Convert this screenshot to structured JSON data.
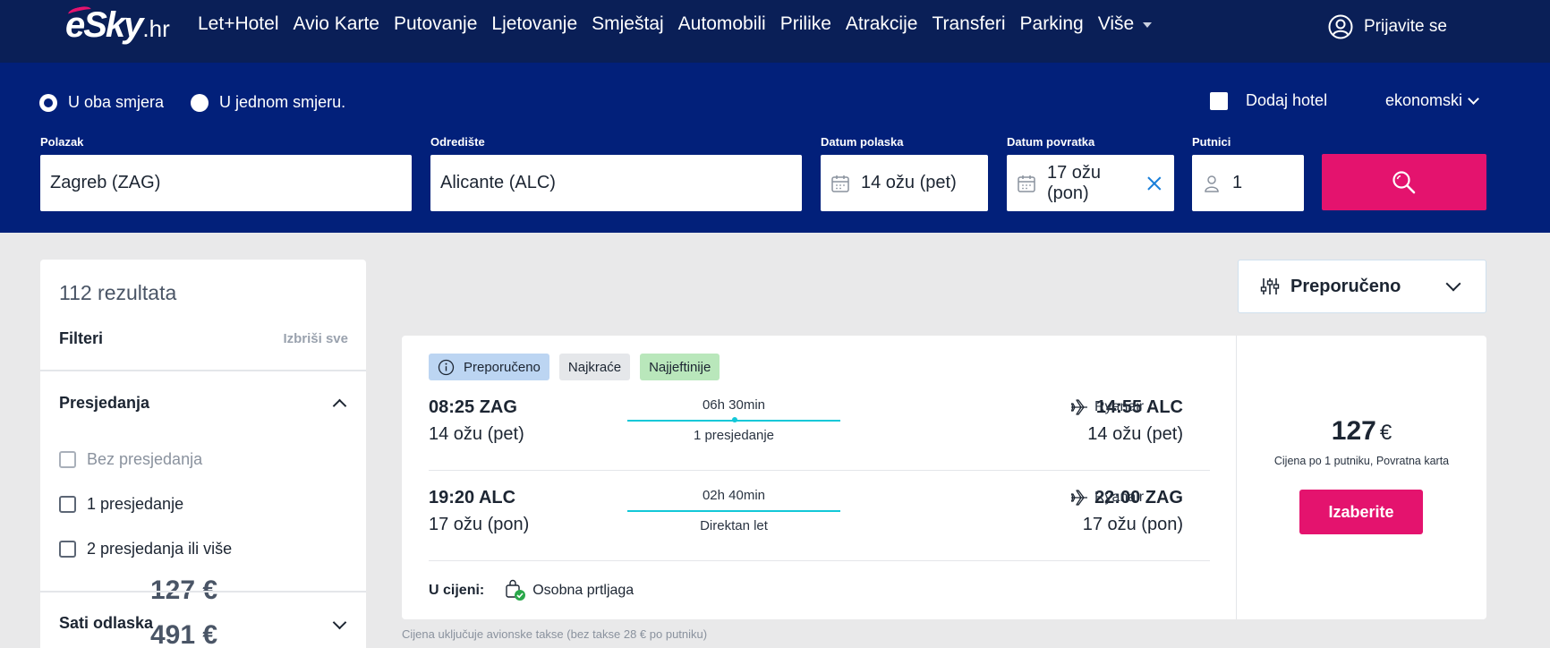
{
  "header": {
    "logo_brand": "eSky",
    "logo_tld": ".hr",
    "nav": [
      "Let+Hotel",
      "Avio Karte",
      "Putovanje",
      "Ljetovanje",
      "Smještaj",
      "Automobili",
      "Prilike",
      "Atrakcije",
      "Transferi",
      "Parking"
    ],
    "more_label": "Više",
    "login_label": "Prijavite se"
  },
  "search": {
    "trip_types": [
      "U oba smjera",
      "U jednom smjeru."
    ],
    "selected_trip_type": "U oba smjera",
    "add_hotel_label": "Dodaj hotel",
    "cabin_class": "ekonomski",
    "origin": {
      "label": "Polazak",
      "value": "Zagreb (ZAG)"
    },
    "destination": {
      "label": "Odredište",
      "value": "Alicante (ALC)"
    },
    "depart_date": {
      "label": "Datum polaska",
      "value": "14 ožu (pet)"
    },
    "return_date": {
      "label": "Datum povratka",
      "value": "17 ožu (pon)"
    },
    "passengers": {
      "label": "Putnici",
      "value": "1"
    }
  },
  "sidebar": {
    "results_count": "112 rezultata",
    "filters_title": "Filteri",
    "clear_all": "Izbriši sve",
    "stops_section": {
      "title": "Presjedanja",
      "options": [
        {
          "label": "Bez presjedanja",
          "price": "",
          "disabled": true
        },
        {
          "label": "1 presjedanje",
          "price": "127 €",
          "disabled": false
        },
        {
          "label": "2 presjedanja ili više",
          "price": "491 €",
          "disabled": false
        }
      ]
    },
    "times_section": {
      "title": "Sati odlaska"
    }
  },
  "sort": {
    "label": "Preporučeno"
  },
  "result": {
    "tags": [
      "Preporučeno",
      "Najkraće",
      "Najjeftinije"
    ],
    "outbound": {
      "dep_time": "08:25 ZAG",
      "dep_date": "14 ožu (pet)",
      "duration": "06h 30min",
      "stops": "1 presjedanje",
      "arr_time": "14:55 ALC",
      "arr_date": "14 ožu (pet)",
      "airline": "Ryanair"
    },
    "inbound": {
      "dep_time": "19:20 ALC",
      "dep_date": "17 ožu (pon)",
      "duration": "02h 40min",
      "stops": "Direktan let",
      "arr_time": "22:00 ZAG",
      "arr_date": "17 ožu (pon)",
      "airline": "Ryanair"
    },
    "included_label": "U cijeni:",
    "included_item": "Osobna prtljaga",
    "price_value": "127",
    "price_currency": "€",
    "price_note": "Cijena po 1 putniku, Povratna karta",
    "select_label": "Izaberite"
  },
  "tax_note": "Cijena uključuje avionske takse (bez takse 28 € po putniku)",
  "colors": {
    "nav_bg": "#0a1f57",
    "search_bg": "#02207a",
    "accent": "#e4136e",
    "route_line": "#12c8d8"
  }
}
